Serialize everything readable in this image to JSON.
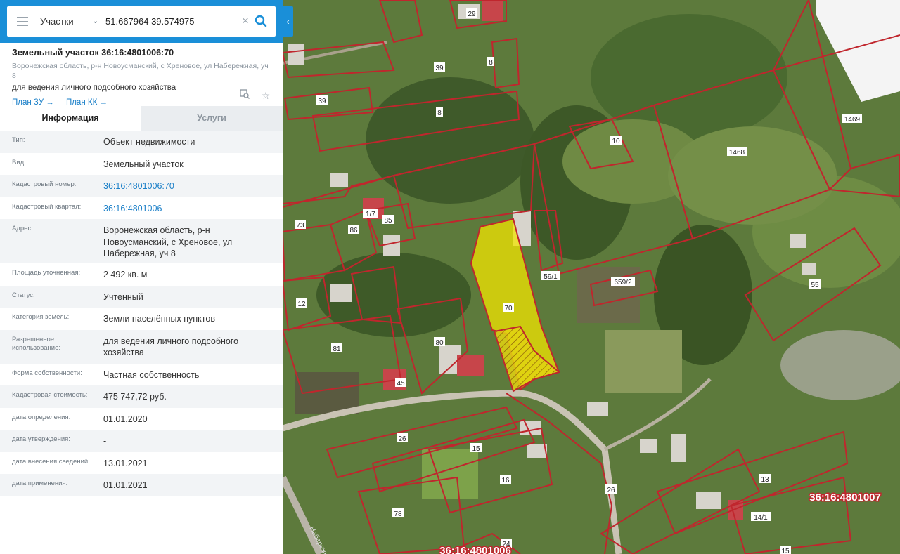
{
  "search": {
    "layer": "Участки",
    "query": "51.667964 39.574975"
  },
  "card": {
    "title": "Земельный участок 36:16:4801006:70",
    "address": "Воронежская область, р-н Новоусманский, с Хреновое, ул Набережная, уч 8",
    "purpose": "для ведения личного подсобного хозяйства",
    "link_plan_zu": "План ЗУ →",
    "link_plan_kk": "План КК →"
  },
  "tabs": [
    {
      "label": "Информация"
    },
    {
      "label": "Услуги"
    }
  ],
  "rows": [
    {
      "key": "Тип:",
      "value": "Объект недвижимости"
    },
    {
      "key": "Вид:",
      "value": "Земельный участок"
    },
    {
      "key": "Кадастровый номер:",
      "value": "36:16:4801006:70"
    },
    {
      "key": "Кадастровый квартал:",
      "value": "36:16:4801006"
    },
    {
      "key": "Адрес:",
      "value": "Воронежская область, р-н Новоусманский, с Хреновое, ул Набережная, уч 8"
    },
    {
      "key": "Площадь уточненная:",
      "value": "2 492 кв. м"
    },
    {
      "key": "Статус:",
      "value": "Учтенный"
    },
    {
      "key": "Категория земель:",
      "value": "Земли населённых пунктов"
    },
    {
      "key": "Разрешенное использование:",
      "value": "для ведения личного подсобного хозяйства"
    },
    {
      "key": "Форма собственности:",
      "value": "Частная собственность"
    },
    {
      "key": "Кадастровая стоимость:",
      "value": "475 747,72 руб."
    },
    {
      "key": "дата определения:",
      "value": "01.01.2020"
    },
    {
      "key": "дата утверждения:",
      "value": "-"
    },
    {
      "key": "дата внесения сведений:",
      "value": "13.01.2021"
    },
    {
      "key": "дата применения:",
      "value": "01.01.2021"
    }
  ],
  "map": {
    "plot_labels": [
      "29",
      "39",
      "8",
      "39",
      "8",
      "10",
      "1469",
      "1468",
      "1/7",
      "85",
      "73",
      "86",
      "59/1",
      "659/2",
      "70",
      "55",
      "12",
      "80",
      "81",
      "45",
      "26",
      "15",
      "16",
      "26",
      "13",
      "78",
      "14/1",
      "24",
      "15"
    ],
    "quarter_labels": [
      "36:16:4801007",
      "36:16:4801006"
    ],
    "street_label": "Набережная",
    "colors": {
      "boundary": "#c0262d",
      "selected_fill": "#f2e600",
      "accent": "#1a8fd8"
    }
  }
}
